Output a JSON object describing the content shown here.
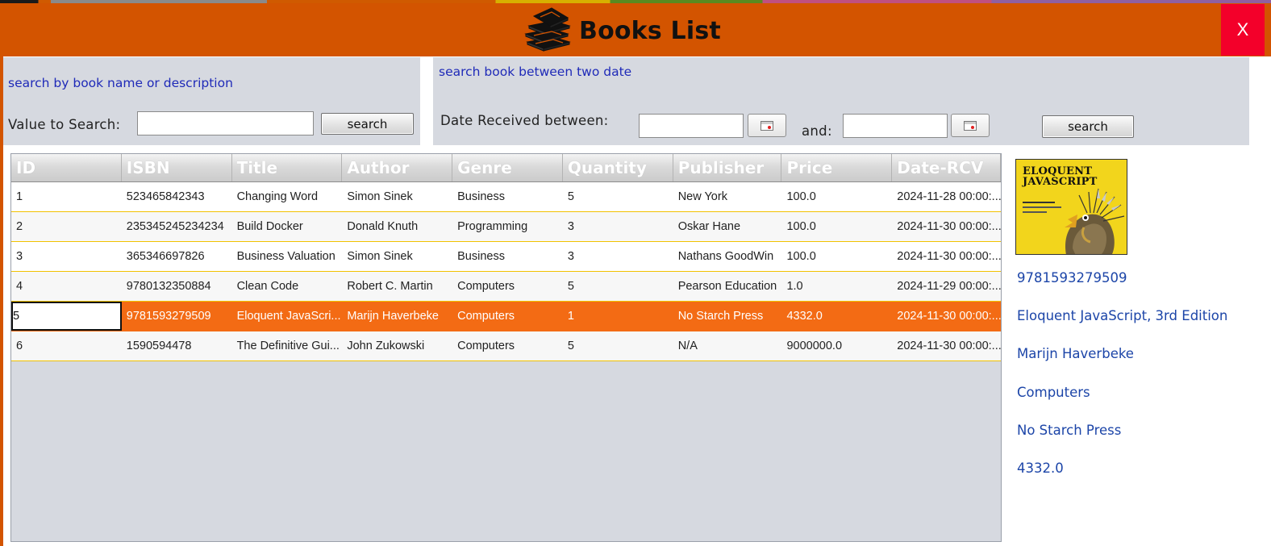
{
  "window": {
    "title": "Books List",
    "close_label": "X",
    "colors": {
      "header": "#d35400",
      "close": "#f3002a",
      "selected_row": "#f36b14",
      "panel": "#d6d9e0",
      "link_text": "#1c45a8"
    }
  },
  "search_by_name": {
    "heading": "search by book name or description",
    "value_label": "Value to Search:",
    "value": "",
    "button_label": "search"
  },
  "search_by_date": {
    "heading": "search book between two date",
    "from_label": "Date Received between:",
    "from_value": "",
    "to_label": "and:",
    "to_value": "",
    "button_label": "search"
  },
  "table": {
    "columns": [
      "ID",
      "ISBN",
      "Title",
      "Author",
      "Genre",
      "Quantity",
      "Publisher",
      "Price",
      "Date-RCV"
    ],
    "rows": [
      [
        "1",
        "523465842343",
        "Changing Word",
        "Simon Sinek",
        "Business",
        "5",
        "New York",
        "100.0",
        "2024-11-28 00:00:..."
      ],
      [
        "2",
        "235345245234234",
        "Build Docker",
        "Donald Knuth",
        "Programming",
        "3",
        "Oskar Hane",
        "100.0",
        "2024-11-30 00:00:..."
      ],
      [
        "3",
        "365346697826",
        "Business Valuation",
        "Simon Sinek",
        "Business",
        "3",
        "Nathans GoodWin",
        "100.0",
        "2024-11-30 00:00:..."
      ],
      [
        "4",
        "9780132350884",
        "Clean Code",
        "Robert C. Martin",
        "Computers",
        "5",
        "Pearson Education",
        "1.0",
        "2024-11-29 00:00:..."
      ],
      [
        "5",
        "9781593279509",
        "Eloquent JavaScri...",
        "Marijn Haverbeke",
        "Computers",
        "1",
        "No Starch Press",
        "4332.0",
        "2024-11-30 00:00:..."
      ],
      [
        "6",
        "1590594478",
        "The Definitive Gui...",
        "John Zukowski",
        "Computers",
        "5",
        "N/A",
        "9000000.0",
        "2024-11-30 00:00:..."
      ]
    ],
    "selected_row": 4
  },
  "details": {
    "cover_title": "ELOQUENT JAVASCRIPT",
    "cover_icon": "cover-bird-illustration",
    "isbn": "9781593279509",
    "title": "Eloquent JavaScript, 3rd Edition",
    "author": "Marijn Haverbeke",
    "genre": "Computers",
    "publisher": "No Starch Press",
    "price": "4332.0"
  }
}
